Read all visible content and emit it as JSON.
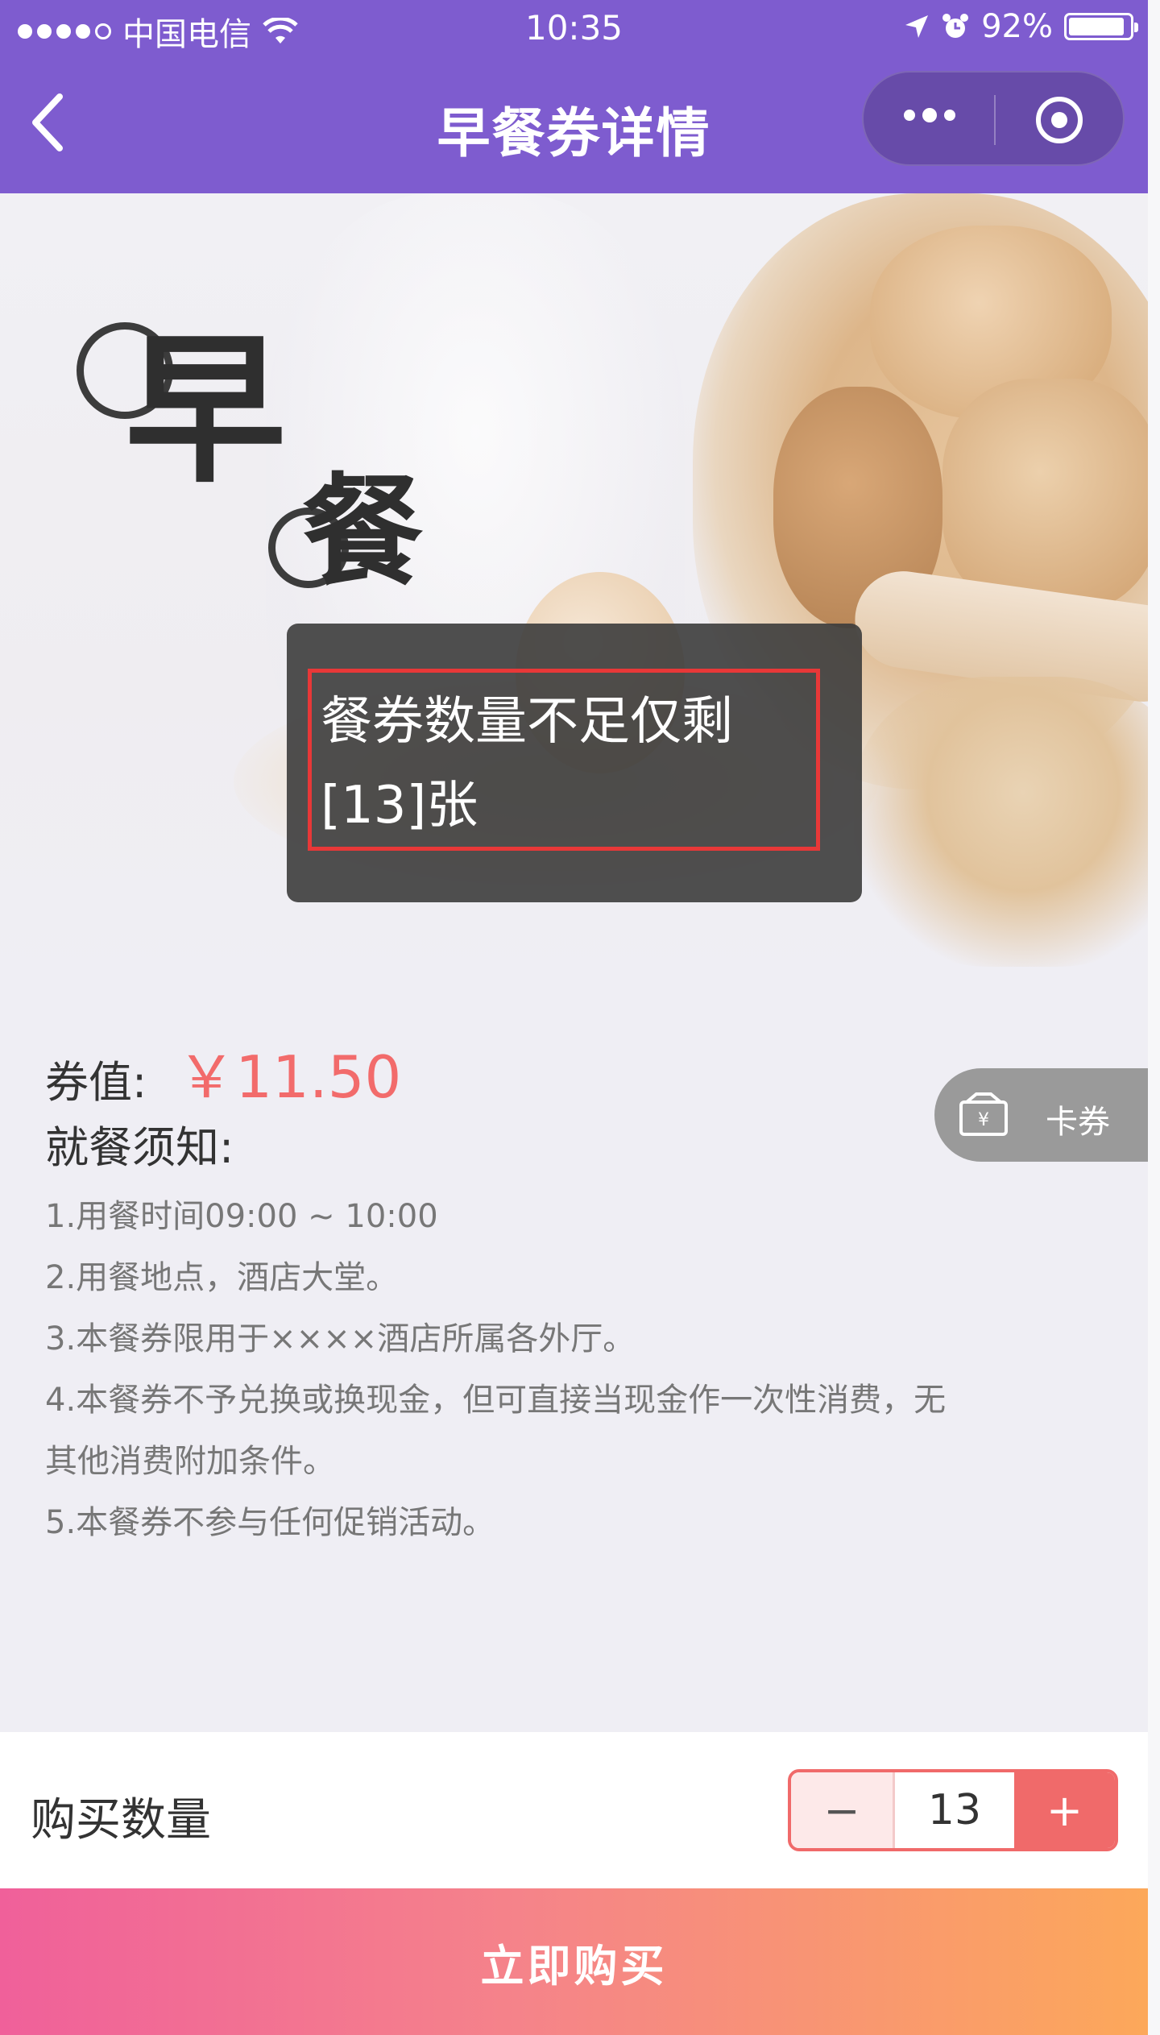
{
  "status_bar": {
    "carrier": "中国电信",
    "time": "10:35",
    "battery_pct": "92%",
    "battery_level": 0.92
  },
  "nav": {
    "title": "早餐券详情"
  },
  "banner": {
    "calligraphy_1": "早",
    "calligraphy_2": "餐"
  },
  "toast": {
    "line1": "餐券数量不足仅剩",
    "line2": "[13]张"
  },
  "coupon": {
    "price_label": "券值:",
    "price_value": "￥11.50",
    "notice_title": "就餐须知:",
    "notes": [
      "1.用餐时间09:00 ~ 10:00",
      "2.用餐地点，酒店大堂。",
      "3.本餐券限用于××××酒店所属各外厅。",
      "4.本餐券不予兑换或换现金，但可直接当现金作一次性消费，无",
      "其他消费附加条件。",
      "5.本餐券不参与任何促销活动。"
    ]
  },
  "card_tab": {
    "label": "卡券"
  },
  "purchase": {
    "qty_label": "购买数量",
    "minus": "−",
    "qty_value": "13",
    "plus": "+",
    "buy_label": "立即购买"
  },
  "colors": {
    "nav": "#7e5ccf",
    "price": "#f26b6b",
    "stepper": "#f06a6a",
    "buy_start": "#f0609a",
    "buy_end": "#fca85a"
  }
}
